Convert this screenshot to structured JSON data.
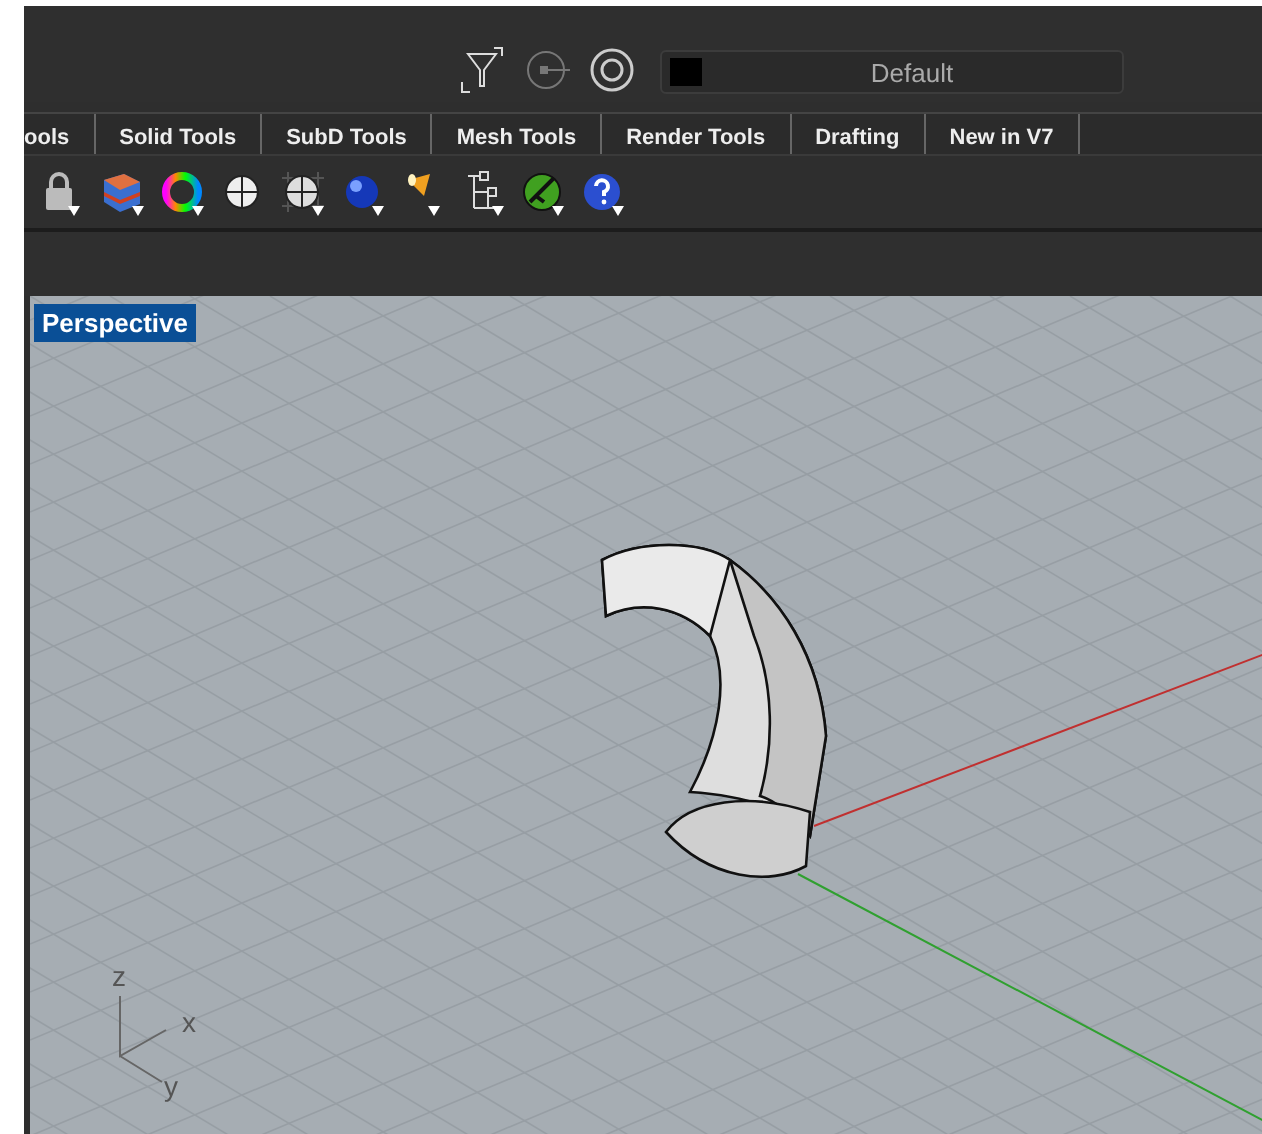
{
  "top_bar": {
    "layer": "Default"
  },
  "tabs": [
    {
      "label": "ools"
    },
    {
      "label": "Solid Tools"
    },
    {
      "label": "SubD Tools"
    },
    {
      "label": "Mesh Tools"
    },
    {
      "label": "Render Tools"
    },
    {
      "label": "Drafting"
    },
    {
      "label": "New in V7"
    }
  ],
  "viewport": {
    "title": "Perspective",
    "axes": {
      "z": "z",
      "x": "x",
      "y": "y"
    }
  }
}
